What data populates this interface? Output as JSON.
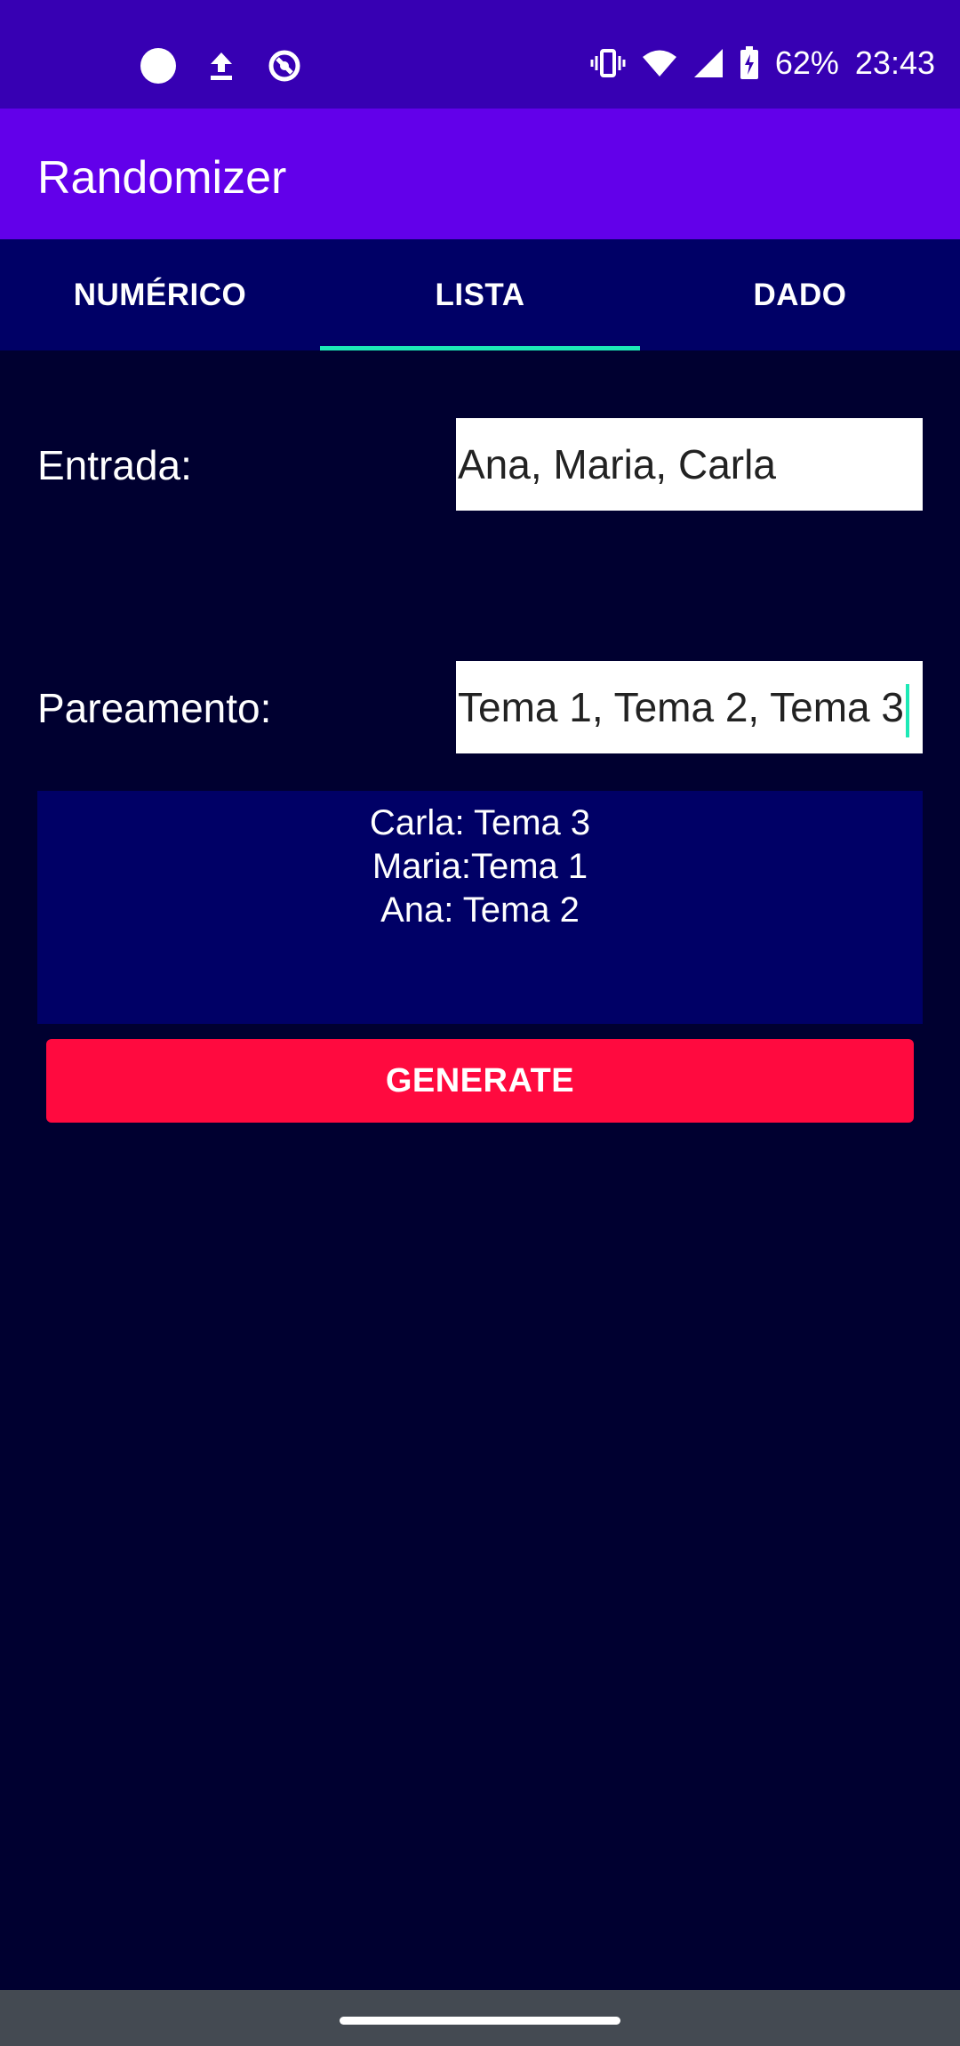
{
  "status_bar": {
    "battery": "62%",
    "time": "23:43",
    "left_icons": [
      "circle-dot-icon",
      "upload-icon",
      "sync-icon"
    ],
    "right_icons": [
      "vibrate-icon",
      "wifi-icon",
      "signal-icon",
      "battery-charging-icon"
    ]
  },
  "app_bar": {
    "title": "Randomizer"
  },
  "tabs": [
    {
      "label": "NUMÉRICO",
      "active": false
    },
    {
      "label": "LISTA",
      "active": true
    },
    {
      "label": "DADO",
      "active": false
    }
  ],
  "form": {
    "entrada_label": "Entrada:",
    "entrada_value": "Ana, Maria, Carla",
    "pareamento_label": "Pareamento:",
    "pareamento_value": "Tema 1, Tema 2, Tema 3"
  },
  "result": {
    "lines": [
      "Carla: Tema 3",
      "Maria:Tema 1",
      "Ana: Tema 2"
    ]
  },
  "generate_button": {
    "label": "GENERATE"
  },
  "colors": {
    "status_bar": "#3700b3",
    "app_bar": "#6200ea",
    "tabs_bg": "#000066",
    "background": "#000030",
    "tab_indicator": "#1de9b6",
    "button": "#ff0a3f",
    "nav_bar": "#444a52"
  }
}
